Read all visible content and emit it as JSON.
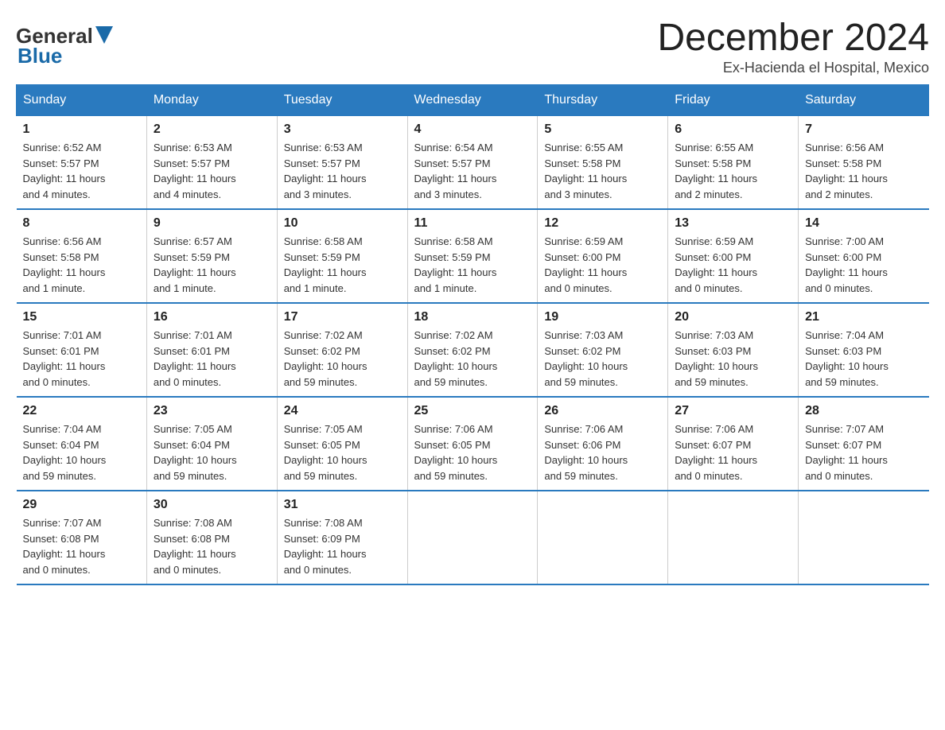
{
  "header": {
    "logo_general": "General",
    "logo_blue": "Blue",
    "title": "December 2024",
    "subtitle": "Ex-Hacienda el Hospital, Mexico"
  },
  "days_of_week": [
    "Sunday",
    "Monday",
    "Tuesday",
    "Wednesday",
    "Thursday",
    "Friday",
    "Saturday"
  ],
  "weeks": [
    [
      {
        "day": "1",
        "info": "Sunrise: 6:52 AM\nSunset: 5:57 PM\nDaylight: 11 hours\nand 4 minutes."
      },
      {
        "day": "2",
        "info": "Sunrise: 6:53 AM\nSunset: 5:57 PM\nDaylight: 11 hours\nand 4 minutes."
      },
      {
        "day": "3",
        "info": "Sunrise: 6:53 AM\nSunset: 5:57 PM\nDaylight: 11 hours\nand 3 minutes."
      },
      {
        "day": "4",
        "info": "Sunrise: 6:54 AM\nSunset: 5:57 PM\nDaylight: 11 hours\nand 3 minutes."
      },
      {
        "day": "5",
        "info": "Sunrise: 6:55 AM\nSunset: 5:58 PM\nDaylight: 11 hours\nand 3 minutes."
      },
      {
        "day": "6",
        "info": "Sunrise: 6:55 AM\nSunset: 5:58 PM\nDaylight: 11 hours\nand 2 minutes."
      },
      {
        "day": "7",
        "info": "Sunrise: 6:56 AM\nSunset: 5:58 PM\nDaylight: 11 hours\nand 2 minutes."
      }
    ],
    [
      {
        "day": "8",
        "info": "Sunrise: 6:56 AM\nSunset: 5:58 PM\nDaylight: 11 hours\nand 1 minute."
      },
      {
        "day": "9",
        "info": "Sunrise: 6:57 AM\nSunset: 5:59 PM\nDaylight: 11 hours\nand 1 minute."
      },
      {
        "day": "10",
        "info": "Sunrise: 6:58 AM\nSunset: 5:59 PM\nDaylight: 11 hours\nand 1 minute."
      },
      {
        "day": "11",
        "info": "Sunrise: 6:58 AM\nSunset: 5:59 PM\nDaylight: 11 hours\nand 1 minute."
      },
      {
        "day": "12",
        "info": "Sunrise: 6:59 AM\nSunset: 6:00 PM\nDaylight: 11 hours\nand 0 minutes."
      },
      {
        "day": "13",
        "info": "Sunrise: 6:59 AM\nSunset: 6:00 PM\nDaylight: 11 hours\nand 0 minutes."
      },
      {
        "day": "14",
        "info": "Sunrise: 7:00 AM\nSunset: 6:00 PM\nDaylight: 11 hours\nand 0 minutes."
      }
    ],
    [
      {
        "day": "15",
        "info": "Sunrise: 7:01 AM\nSunset: 6:01 PM\nDaylight: 11 hours\nand 0 minutes."
      },
      {
        "day": "16",
        "info": "Sunrise: 7:01 AM\nSunset: 6:01 PM\nDaylight: 11 hours\nand 0 minutes."
      },
      {
        "day": "17",
        "info": "Sunrise: 7:02 AM\nSunset: 6:02 PM\nDaylight: 10 hours\nand 59 minutes."
      },
      {
        "day": "18",
        "info": "Sunrise: 7:02 AM\nSunset: 6:02 PM\nDaylight: 10 hours\nand 59 minutes."
      },
      {
        "day": "19",
        "info": "Sunrise: 7:03 AM\nSunset: 6:02 PM\nDaylight: 10 hours\nand 59 minutes."
      },
      {
        "day": "20",
        "info": "Sunrise: 7:03 AM\nSunset: 6:03 PM\nDaylight: 10 hours\nand 59 minutes."
      },
      {
        "day": "21",
        "info": "Sunrise: 7:04 AM\nSunset: 6:03 PM\nDaylight: 10 hours\nand 59 minutes."
      }
    ],
    [
      {
        "day": "22",
        "info": "Sunrise: 7:04 AM\nSunset: 6:04 PM\nDaylight: 10 hours\nand 59 minutes."
      },
      {
        "day": "23",
        "info": "Sunrise: 7:05 AM\nSunset: 6:04 PM\nDaylight: 10 hours\nand 59 minutes."
      },
      {
        "day": "24",
        "info": "Sunrise: 7:05 AM\nSunset: 6:05 PM\nDaylight: 10 hours\nand 59 minutes."
      },
      {
        "day": "25",
        "info": "Sunrise: 7:06 AM\nSunset: 6:05 PM\nDaylight: 10 hours\nand 59 minutes."
      },
      {
        "day": "26",
        "info": "Sunrise: 7:06 AM\nSunset: 6:06 PM\nDaylight: 10 hours\nand 59 minutes."
      },
      {
        "day": "27",
        "info": "Sunrise: 7:06 AM\nSunset: 6:07 PM\nDaylight: 11 hours\nand 0 minutes."
      },
      {
        "day": "28",
        "info": "Sunrise: 7:07 AM\nSunset: 6:07 PM\nDaylight: 11 hours\nand 0 minutes."
      }
    ],
    [
      {
        "day": "29",
        "info": "Sunrise: 7:07 AM\nSunset: 6:08 PM\nDaylight: 11 hours\nand 0 minutes."
      },
      {
        "day": "30",
        "info": "Sunrise: 7:08 AM\nSunset: 6:08 PM\nDaylight: 11 hours\nand 0 minutes."
      },
      {
        "day": "31",
        "info": "Sunrise: 7:08 AM\nSunset: 6:09 PM\nDaylight: 11 hours\nand 0 minutes."
      },
      {
        "day": "",
        "info": ""
      },
      {
        "day": "",
        "info": ""
      },
      {
        "day": "",
        "info": ""
      },
      {
        "day": "",
        "info": ""
      }
    ]
  ]
}
